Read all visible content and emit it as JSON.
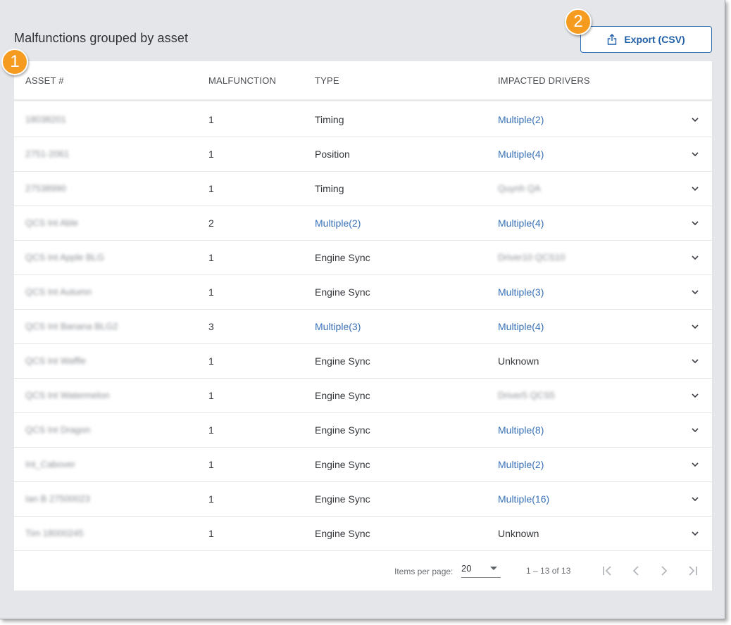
{
  "page": {
    "title": "Malfunctions grouped by asset",
    "export_label": "Export (CSV)"
  },
  "callouts": [
    "1",
    "2"
  ],
  "table": {
    "headers": {
      "asset": "ASSET #",
      "malfunction": "MALFUNCTION",
      "type": "TYPE",
      "drivers": "IMPACTED DRIVERS"
    },
    "rows": [
      {
        "asset": "18038201",
        "malfunction": "1",
        "type": "Timing",
        "drivers": "Multiple(2)"
      },
      {
        "asset": "2751-2061",
        "malfunction": "1",
        "type": "Position",
        "drivers": "Multiple(4)"
      },
      {
        "asset": "27538990",
        "malfunction": "1",
        "type": "Timing",
        "drivers": "Quynh QA"
      },
      {
        "asset": "QCS Int Able",
        "malfunction": "2",
        "type": "Multiple(2)",
        "drivers": "Multiple(4)"
      },
      {
        "asset": "QCS Int Apple BLG",
        "malfunction": "1",
        "type": "Engine Sync",
        "drivers": "Driver10 QCS10"
      },
      {
        "asset": "QCS Int Autumn",
        "malfunction": "1",
        "type": "Engine Sync",
        "drivers": "Multiple(3)"
      },
      {
        "asset": "QCS Int Banana BLG2",
        "malfunction": "3",
        "type": "Multiple(3)",
        "drivers": "Multiple(4)"
      },
      {
        "asset": "QCS Int Waffle",
        "malfunction": "1",
        "type": "Engine Sync",
        "drivers": "Unknown"
      },
      {
        "asset": "QCS Int Watermelon",
        "malfunction": "1",
        "type": "Engine Sync",
        "drivers": "Driver5 QCS5"
      },
      {
        "asset": "QCS Int Dragon",
        "malfunction": "1",
        "type": "Engine Sync",
        "drivers": "Multiple(8)"
      },
      {
        "asset": "Int_Cabover",
        "malfunction": "1",
        "type": "Engine Sync",
        "drivers": "Multiple(2)"
      },
      {
        "asset": "Ian B 27500023",
        "malfunction": "1",
        "type": "Engine Sync",
        "drivers": "Multiple(16)"
      },
      {
        "asset": "Tim 18000245",
        "malfunction": "1",
        "type": "Engine Sync",
        "drivers": "Unknown"
      }
    ]
  },
  "pagination": {
    "items_per_page_label": "Items per page:",
    "items_per_page_value": "20",
    "range": "1 – 13 of 13"
  },
  "colors": {
    "accent": "#3a72b8",
    "callout": "#f59c20",
    "background": "#e5e6e9"
  },
  "icons": [
    "export-icon",
    "chevron-down-icon",
    "first-page-icon",
    "prev-page-icon",
    "next-page-icon",
    "last-page-icon"
  ]
}
